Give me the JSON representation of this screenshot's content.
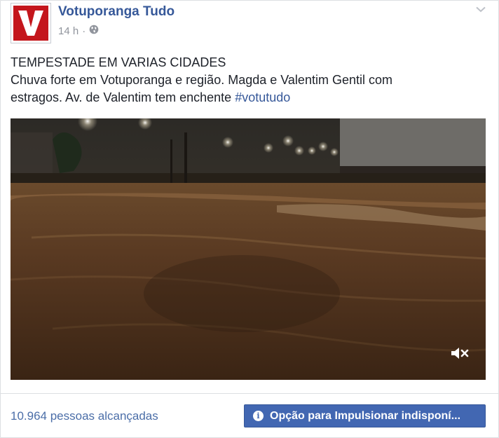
{
  "post": {
    "page_name": "Votuporanga Tudo",
    "timestamp": "14 h",
    "separator": "·",
    "privacy_icon": "globe-icon",
    "text_line1": "TEMPESTADE EM VARIAS CIDADES",
    "text_line2": "Chuva forte em Votuporanga e região. Magda e Valentim Gentil com",
    "text_line3": "estragos. Av. de Valentim tem enchente ",
    "hashtag": "#votutudo"
  },
  "video": {
    "mute_icon": "volume-muted-icon"
  },
  "footer": {
    "reach": "10.964 pessoas alcançadas",
    "boost_label": "Opção para Impulsionar indisponí..."
  },
  "colors": {
    "link": "#365899",
    "button": "#4267b2",
    "logo_red": "#c4161c"
  }
}
